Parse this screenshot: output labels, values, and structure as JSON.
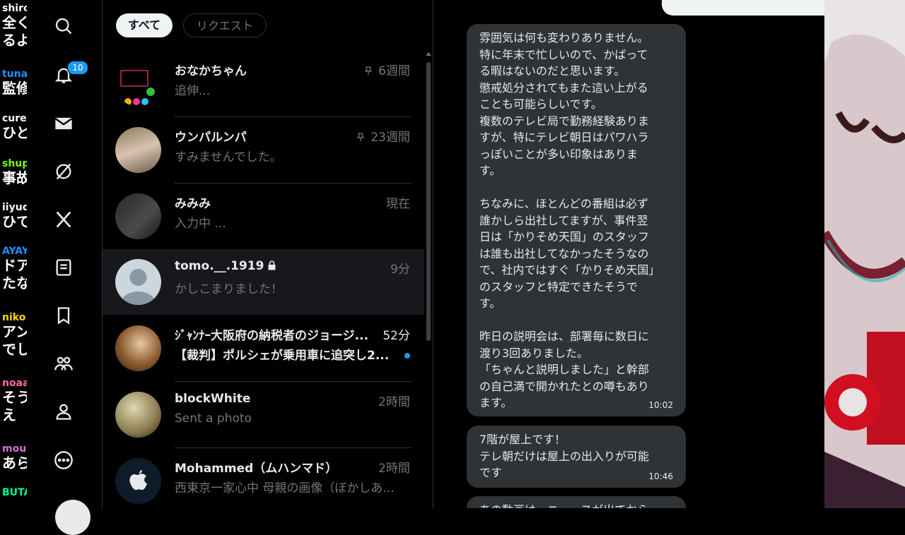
{
  "chat_overlay": [
    {
      "user": "shiro",
      "user_color": "#ffffff",
      "text": "全く",
      "text2": "るよ"
    },
    {
      "user": "tuna",
      "user_color": "#1e90ff",
      "text": "監修"
    },
    {
      "user": "cure",
      "user_color": "#ffffff",
      "text": "ひと"
    },
    {
      "user": "shup",
      "user_color": "#7cfc00",
      "text": "事故"
    },
    {
      "user": "iiyud",
      "user_color": "#ffffff",
      "text": "ひて"
    },
    {
      "user": "AYAY",
      "user_color": "#1e90ff",
      "text": "ドア",
      "text2": "たな"
    },
    {
      "user": "niko",
      "user_color": "#ffd700",
      "text": "アン",
      "text2": "でし"
    },
    {
      "user": "noaa",
      "user_color": "#ff69b4",
      "text": "そう",
      "text2": "え"
    },
    {
      "user": "mou",
      "user_color": "#da70d6",
      "text": "あら"
    },
    {
      "user": "BUTA",
      "user_color": "#00fa9a",
      "text": ""
    }
  ],
  "nav": {
    "items": [
      "search",
      "notifications",
      "messages",
      "grok",
      "premium",
      "lists",
      "bookmarks",
      "communities",
      "profile",
      "more"
    ],
    "notifications_badge": "10"
  },
  "filters": {
    "all": "すべて",
    "requests": "リクエスト"
  },
  "conversations": [
    {
      "name": "おなかちゃん",
      "time": "6週間",
      "preview": "追伸...",
      "pinned": true,
      "locked": false,
      "unread": false,
      "selected": false
    },
    {
      "name": "ウンパルンパ",
      "time": "23週間",
      "preview": "すみませんでした。",
      "pinned": true,
      "locked": false,
      "unread": false,
      "selected": false
    },
    {
      "name": "みみみ",
      "time": "現在",
      "preview": "入力中 ...",
      "pinned": false,
      "locked": false,
      "unread": false,
      "selected": false
    },
    {
      "name": "tomo.__.1919",
      "time": "9分",
      "preview": "かしこまりました！",
      "pinned": false,
      "locked": true,
      "unread": false,
      "selected": true
    },
    {
      "name": "ｼﾞｬﾝﾅｰ大阪府の納税者のジョージ...",
      "time": "52分",
      "preview": "【裁判】ポルシェが乗用車に追突し2...",
      "pinned": false,
      "locked": false,
      "unread": true,
      "selected": false
    },
    {
      "name": "blockWhite",
      "time": "2時間",
      "preview": "Sent a photo",
      "pinned": false,
      "locked": false,
      "unread": false,
      "selected": false
    },
    {
      "name": "Mohammed（ムハンマド）",
      "time": "2時間",
      "preview": "西東京一家心中 母親の画像（ぼかしあ...",
      "pinned": false,
      "locked": false,
      "unread": false,
      "selected": false
    }
  ],
  "messages": [
    {
      "text": "雰囲気は何も変わりありません。\n特に年末で忙しいので、かばって\nる暇はないのだと思います。\n懲戒処分されてもまた這い上がる\nことも可能らしいです。\n複数のテレビ局で勤務経験ありま\nすが、特にテレビ朝日はパワハラ\nっぽいことが多い印象はありま\nす。\n\nちなみに、ほとんどの番組は必ず\n誰かしら出社してますが、事件翌\n日は「かりそめ天国」のスタッフ\nは誰も出社してなかったそうなの\nで、社内ではすぐ「かりそめ天国」\nのスタッフと特定できたそうで\nす。\n\n昨日の説明会は、部署毎に数日に\n渡り3回ありました。\n「ちゃんと説明しました」と幹部\nの自己満で開かれたとの噂もあり\nます。",
      "time": "10:02"
    },
    {
      "text": "7階が屋上です！\nテレ朝だけは屋上の出入りが可能\nです",
      "time": "10:46"
    },
    {
      "text": "あの動画は、ニュースが出てから",
      "time": ""
    }
  ],
  "colors": {
    "accent": "#1d9bf0",
    "bubble": "#2f3336",
    "background": "#000000"
  }
}
